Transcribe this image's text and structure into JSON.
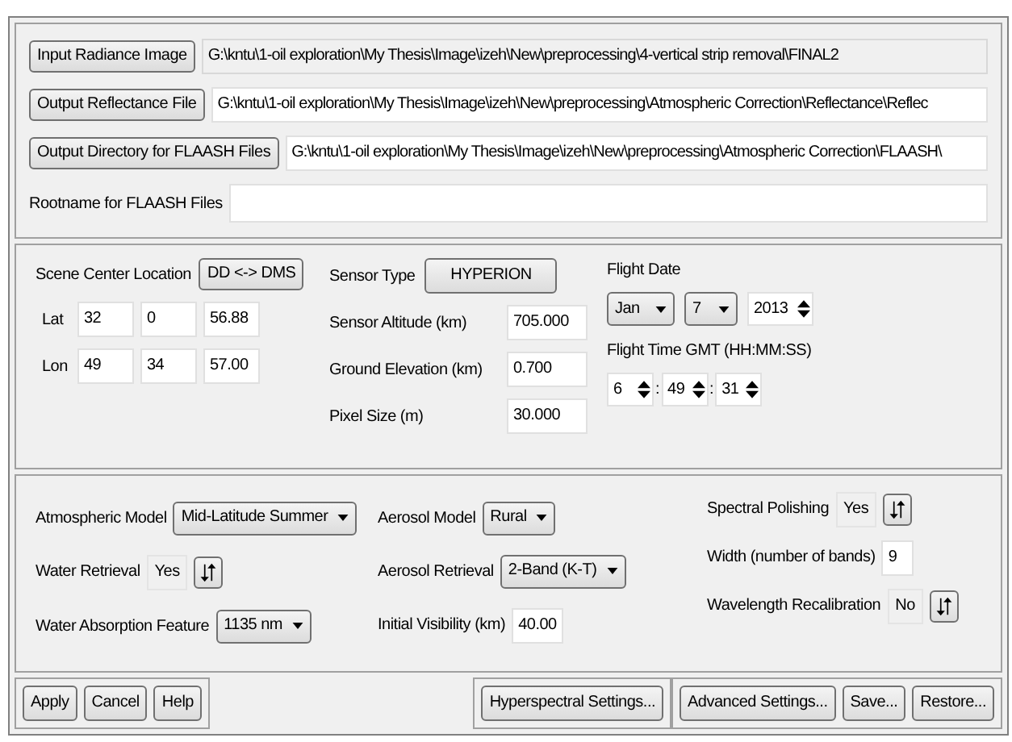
{
  "files": [
    {
      "button": "Input Radiance Image",
      "value": "G:\\kntu\\1-oil exploration\\My Thesis\\Image\\izeh\\New\\preprocessing\\4-vertical strip removal\\FINAL2",
      "readonly": true
    },
    {
      "button": "Output Reflectance File",
      "value": "G:\\kntu\\1-oil exploration\\My Thesis\\Image\\izeh\\New\\preprocessing\\Atmospheric Correction\\Reflectance\\Reflec",
      "readonly": false
    },
    {
      "button": "Output Directory for FLAASH Files",
      "value": "G:\\kntu\\1-oil exploration\\My Thesis\\Image\\izeh\\New\\preprocessing\\Atmospheric Correction\\FLAASH\\",
      "readonly": false
    }
  ],
  "rootname": {
    "label": "Rootname for FLAASH Files"
  },
  "scene": {
    "label": "Scene Center Location",
    "convert_button": "DD <-> DMS",
    "coords": [
      {
        "label": "Lat",
        "values": [
          "32",
          "0",
          "56.88"
        ]
      },
      {
        "label": "Lon",
        "values": [
          "49",
          "34",
          "57.00"
        ]
      }
    ]
  },
  "sensor": {
    "label": "Sensor Type",
    "button": "HYPERION",
    "fields": [
      {
        "label": "Sensor Altitude (km)",
        "value": "705.000"
      },
      {
        "label": "Ground Elevation (km)",
        "value": "0.700"
      },
      {
        "label": "Pixel Size (m)",
        "value": "30.000"
      }
    ]
  },
  "flight": {
    "date_label": "Flight Date",
    "month": "Jan",
    "day": "7",
    "year": "2013",
    "time_label": "Flight Time GMT (HH:MM:SS)",
    "time": [
      "6",
      "49",
      "31"
    ],
    "separator": ":"
  },
  "params": [
    [
      {
        "kind": "dropdown",
        "label": "Atmospheric Model",
        "value": "Mid-Latitude Summer"
      },
      {
        "kind": "toggle",
        "label": "Water Retrieval",
        "value": "Yes"
      },
      {
        "kind": "dropdown",
        "label": "Water Absorption Feature",
        "value": "1135 nm"
      }
    ],
    [
      {
        "kind": "dropdown",
        "label": "Aerosol Model",
        "value": "Rural"
      },
      {
        "kind": "dropdown",
        "label": "Aerosol Retrieval",
        "value": "2-Band (K-T)"
      },
      {
        "kind": "input",
        "label": "Initial Visibility (km)",
        "value": "40.00"
      }
    ],
    [
      {
        "kind": "toggle",
        "label": "Spectral Polishing",
        "value": "Yes"
      },
      {
        "kind": "input",
        "label": "Width (number of bands)",
        "value": "9"
      },
      {
        "kind": "toggle",
        "label": "Wavelength Recalibration",
        "value": "No"
      }
    ]
  ],
  "buttons_left": [
    "Apply",
    "Cancel",
    "Help"
  ],
  "buttons_middle": [
    "Hyperspectral Settings..."
  ],
  "buttons_right": [
    "Advanced Settings...",
    "Save...",
    "Restore..."
  ]
}
